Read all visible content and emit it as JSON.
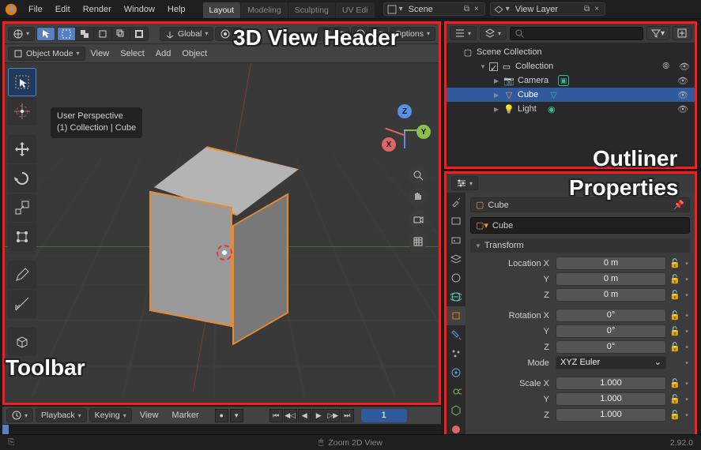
{
  "version": "2.92.0",
  "topbar": {
    "menus": [
      "File",
      "Edit",
      "Render",
      "Window",
      "Help"
    ],
    "workspaces": [
      "Layout",
      "Modeling",
      "Sculpting",
      "UV Edi"
    ],
    "active_workspace": 0,
    "scene_label": "Scene",
    "viewlayer_label": "View Layer"
  },
  "labels": {
    "header": "3D View Header",
    "toolbar": "Toolbar",
    "outliner": "Outliner",
    "properties": "Properties"
  },
  "view3d": {
    "orientation": "Global",
    "options": "Options",
    "mode": "Object Mode",
    "menus": [
      "View",
      "Select",
      "Add",
      "Object"
    ],
    "overlay": {
      "line1": "User Perspective",
      "line2": "(1) Collection | Cube"
    },
    "gizmo": {
      "x": "X",
      "y": "Y",
      "z": "Z"
    }
  },
  "outliner": {
    "scene_collection": "Scene Collection",
    "collection": "Collection",
    "items": [
      {
        "name": "Camera",
        "icon": "camera"
      },
      {
        "name": "Cube",
        "icon": "mesh",
        "selected": true
      },
      {
        "name": "Light",
        "icon": "light"
      }
    ],
    "search_placeholder": ""
  },
  "properties": {
    "item_name": "Cube",
    "name_field": "Cube",
    "panel": "Transform",
    "location": {
      "label": "Location X",
      "x": "0 m",
      "y": "0 m",
      "z": "0 m"
    },
    "rotation": {
      "label": "Rotation X",
      "x": "0°",
      "y": "0°",
      "z": "0°"
    },
    "mode_label": "Mode",
    "mode_value": "XYZ Euler",
    "scale": {
      "label": "Scale X",
      "x": "1.000",
      "y": "1.000",
      "z": "1.000"
    },
    "ylabel": "Y",
    "zlabel": "Z"
  },
  "timeline": {
    "playback": "Playback",
    "keying": "Keying",
    "menus": [
      "View",
      "Marker"
    ],
    "current_frame": "1"
  },
  "status": {
    "hint": "Zoom 2D View"
  }
}
